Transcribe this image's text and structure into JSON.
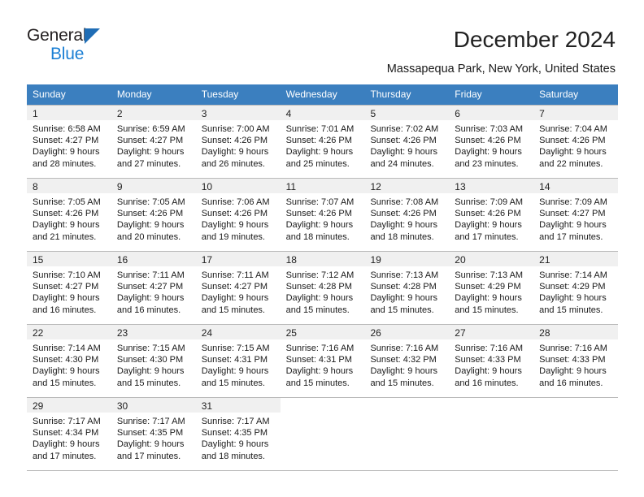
{
  "brand": {
    "line1": "General",
    "line2": "Blue",
    "triangle_color": "#1f6db5",
    "blue_text_color": "#1b7fd4"
  },
  "header": {
    "title": "December 2024",
    "subtitle": "Massapequa Park, New York, United States",
    "header_bg_color": "#3b7fbf"
  },
  "weekdays": [
    "Sunday",
    "Monday",
    "Tuesday",
    "Wednesday",
    "Thursday",
    "Friday",
    "Saturday"
  ],
  "weeks": [
    [
      {
        "day": "1",
        "sunrise": "Sunrise: 6:58 AM",
        "sunset": "Sunset: 4:27 PM",
        "daylight1": "Daylight: 9 hours",
        "daylight2": "and 28 minutes."
      },
      {
        "day": "2",
        "sunrise": "Sunrise: 6:59 AM",
        "sunset": "Sunset: 4:27 PM",
        "daylight1": "Daylight: 9 hours",
        "daylight2": "and 27 minutes."
      },
      {
        "day": "3",
        "sunrise": "Sunrise: 7:00 AM",
        "sunset": "Sunset: 4:26 PM",
        "daylight1": "Daylight: 9 hours",
        "daylight2": "and 26 minutes."
      },
      {
        "day": "4",
        "sunrise": "Sunrise: 7:01 AM",
        "sunset": "Sunset: 4:26 PM",
        "daylight1": "Daylight: 9 hours",
        "daylight2": "and 25 minutes."
      },
      {
        "day": "5",
        "sunrise": "Sunrise: 7:02 AM",
        "sunset": "Sunset: 4:26 PM",
        "daylight1": "Daylight: 9 hours",
        "daylight2": "and 24 minutes."
      },
      {
        "day": "6",
        "sunrise": "Sunrise: 7:03 AM",
        "sunset": "Sunset: 4:26 PM",
        "daylight1": "Daylight: 9 hours",
        "daylight2": "and 23 minutes."
      },
      {
        "day": "7",
        "sunrise": "Sunrise: 7:04 AM",
        "sunset": "Sunset: 4:26 PM",
        "daylight1": "Daylight: 9 hours",
        "daylight2": "and 22 minutes."
      }
    ],
    [
      {
        "day": "8",
        "sunrise": "Sunrise: 7:05 AM",
        "sunset": "Sunset: 4:26 PM",
        "daylight1": "Daylight: 9 hours",
        "daylight2": "and 21 minutes."
      },
      {
        "day": "9",
        "sunrise": "Sunrise: 7:05 AM",
        "sunset": "Sunset: 4:26 PM",
        "daylight1": "Daylight: 9 hours",
        "daylight2": "and 20 minutes."
      },
      {
        "day": "10",
        "sunrise": "Sunrise: 7:06 AM",
        "sunset": "Sunset: 4:26 PM",
        "daylight1": "Daylight: 9 hours",
        "daylight2": "and 19 minutes."
      },
      {
        "day": "11",
        "sunrise": "Sunrise: 7:07 AM",
        "sunset": "Sunset: 4:26 PM",
        "daylight1": "Daylight: 9 hours",
        "daylight2": "and 18 minutes."
      },
      {
        "day": "12",
        "sunrise": "Sunrise: 7:08 AM",
        "sunset": "Sunset: 4:26 PM",
        "daylight1": "Daylight: 9 hours",
        "daylight2": "and 18 minutes."
      },
      {
        "day": "13",
        "sunrise": "Sunrise: 7:09 AM",
        "sunset": "Sunset: 4:26 PM",
        "daylight1": "Daylight: 9 hours",
        "daylight2": "and 17 minutes."
      },
      {
        "day": "14",
        "sunrise": "Sunrise: 7:09 AM",
        "sunset": "Sunset: 4:27 PM",
        "daylight1": "Daylight: 9 hours",
        "daylight2": "and 17 minutes."
      }
    ],
    [
      {
        "day": "15",
        "sunrise": "Sunrise: 7:10 AM",
        "sunset": "Sunset: 4:27 PM",
        "daylight1": "Daylight: 9 hours",
        "daylight2": "and 16 minutes."
      },
      {
        "day": "16",
        "sunrise": "Sunrise: 7:11 AM",
        "sunset": "Sunset: 4:27 PM",
        "daylight1": "Daylight: 9 hours",
        "daylight2": "and 16 minutes."
      },
      {
        "day": "17",
        "sunrise": "Sunrise: 7:11 AM",
        "sunset": "Sunset: 4:27 PM",
        "daylight1": "Daylight: 9 hours",
        "daylight2": "and 15 minutes."
      },
      {
        "day": "18",
        "sunrise": "Sunrise: 7:12 AM",
        "sunset": "Sunset: 4:28 PM",
        "daylight1": "Daylight: 9 hours",
        "daylight2": "and 15 minutes."
      },
      {
        "day": "19",
        "sunrise": "Sunrise: 7:13 AM",
        "sunset": "Sunset: 4:28 PM",
        "daylight1": "Daylight: 9 hours",
        "daylight2": "and 15 minutes."
      },
      {
        "day": "20",
        "sunrise": "Sunrise: 7:13 AM",
        "sunset": "Sunset: 4:29 PM",
        "daylight1": "Daylight: 9 hours",
        "daylight2": "and 15 minutes."
      },
      {
        "day": "21",
        "sunrise": "Sunrise: 7:14 AM",
        "sunset": "Sunset: 4:29 PM",
        "daylight1": "Daylight: 9 hours",
        "daylight2": "and 15 minutes."
      }
    ],
    [
      {
        "day": "22",
        "sunrise": "Sunrise: 7:14 AM",
        "sunset": "Sunset: 4:30 PM",
        "daylight1": "Daylight: 9 hours",
        "daylight2": "and 15 minutes."
      },
      {
        "day": "23",
        "sunrise": "Sunrise: 7:15 AM",
        "sunset": "Sunset: 4:30 PM",
        "daylight1": "Daylight: 9 hours",
        "daylight2": "and 15 minutes."
      },
      {
        "day": "24",
        "sunrise": "Sunrise: 7:15 AM",
        "sunset": "Sunset: 4:31 PM",
        "daylight1": "Daylight: 9 hours",
        "daylight2": "and 15 minutes."
      },
      {
        "day": "25",
        "sunrise": "Sunrise: 7:16 AM",
        "sunset": "Sunset: 4:31 PM",
        "daylight1": "Daylight: 9 hours",
        "daylight2": "and 15 minutes."
      },
      {
        "day": "26",
        "sunrise": "Sunrise: 7:16 AM",
        "sunset": "Sunset: 4:32 PM",
        "daylight1": "Daylight: 9 hours",
        "daylight2": "and 15 minutes."
      },
      {
        "day": "27",
        "sunrise": "Sunrise: 7:16 AM",
        "sunset": "Sunset: 4:33 PM",
        "daylight1": "Daylight: 9 hours",
        "daylight2": "and 16 minutes."
      },
      {
        "day": "28",
        "sunrise": "Sunrise: 7:16 AM",
        "sunset": "Sunset: 4:33 PM",
        "daylight1": "Daylight: 9 hours",
        "daylight2": "and 16 minutes."
      }
    ],
    [
      {
        "day": "29",
        "sunrise": "Sunrise: 7:17 AM",
        "sunset": "Sunset: 4:34 PM",
        "daylight1": "Daylight: 9 hours",
        "daylight2": "and 17 minutes."
      },
      {
        "day": "30",
        "sunrise": "Sunrise: 7:17 AM",
        "sunset": "Sunset: 4:35 PM",
        "daylight1": "Daylight: 9 hours",
        "daylight2": "and 17 minutes."
      },
      {
        "day": "31",
        "sunrise": "Sunrise: 7:17 AM",
        "sunset": "Sunset: 4:35 PM",
        "daylight1": "Daylight: 9 hours",
        "daylight2": "and 18 minutes."
      },
      {
        "day": "",
        "sunrise": "",
        "sunset": "",
        "daylight1": "",
        "daylight2": ""
      },
      {
        "day": "",
        "sunrise": "",
        "sunset": "",
        "daylight1": "",
        "daylight2": ""
      },
      {
        "day": "",
        "sunrise": "",
        "sunset": "",
        "daylight1": "",
        "daylight2": ""
      },
      {
        "day": "",
        "sunrise": "",
        "sunset": "",
        "daylight1": "",
        "daylight2": ""
      }
    ]
  ]
}
